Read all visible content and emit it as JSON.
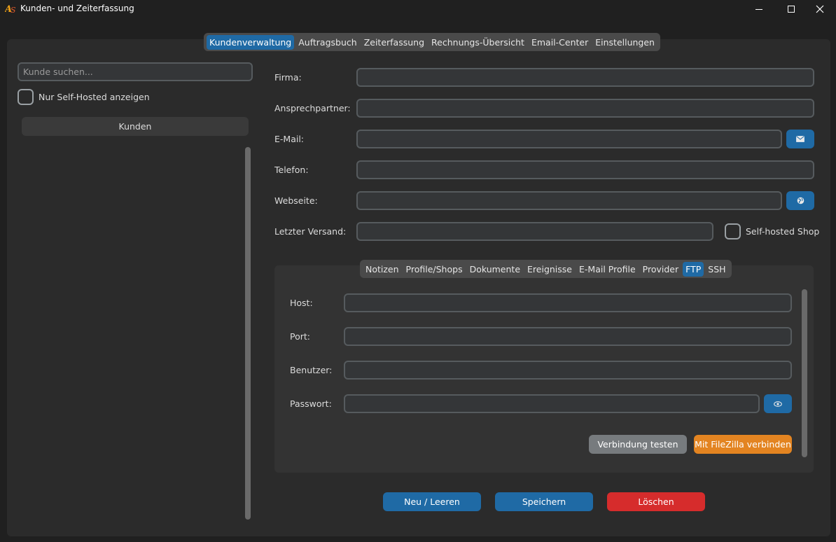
{
  "window": {
    "title": "Kunden- und Zeiterfassung"
  },
  "tabs": [
    {
      "label": "Kundenverwaltung",
      "active": true
    },
    {
      "label": "Auftragsbuch",
      "active": false
    },
    {
      "label": "Zeiterfassung",
      "active": false
    },
    {
      "label": "Rechnungs-Übersicht",
      "active": false
    },
    {
      "label": "Email-Center",
      "active": false
    },
    {
      "label": "Einstellungen",
      "active": false
    }
  ],
  "sidebar": {
    "search_placeholder": "Kunde suchen...",
    "filter_label": "Nur Self-Hosted anzeigen",
    "list_header": "Kunden"
  },
  "form": {
    "firma_label": "Firma:",
    "ansprechpartner_label": "Ansprechpartner:",
    "email_label": "E-Mail:",
    "telefon_label": "Telefon:",
    "webseite_label": "Webseite:",
    "letzter_versand_label": "Letzter Versand:",
    "self_hosted_label": "Self-hosted Shop"
  },
  "subtabs": [
    {
      "label": "Notizen",
      "active": false
    },
    {
      "label": "Profile/Shops",
      "active": false
    },
    {
      "label": "Dokumente",
      "active": false
    },
    {
      "label": "Ereignisse",
      "active": false
    },
    {
      "label": "E-Mail Profile",
      "active": false
    },
    {
      "label": "Provider",
      "active": false
    },
    {
      "label": "FTP",
      "active": true
    },
    {
      "label": "SSH",
      "active": false
    }
  ],
  "ftp": {
    "host_label": "Host:",
    "port_label": "Port:",
    "benutzer_label": "Benutzer:",
    "passwort_label": "Passwort:",
    "test_button": "Verbindung testen",
    "filezilla_button": "Mit FileZilla verbinden"
  },
  "actions": {
    "new_button": "Neu / Leeren",
    "save_button": "Speichern",
    "delete_button": "Löschen"
  },
  "colors": {
    "accent": "#1f6aa5",
    "danger": "#d62c2c",
    "warning": "#e38421",
    "neutral": "#777b7e"
  }
}
